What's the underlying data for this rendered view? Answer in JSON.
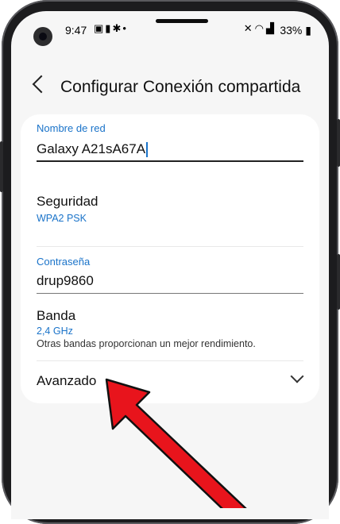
{
  "status_bar": {
    "time": "9:47",
    "left_icons": [
      "image-icon",
      "lock-icon",
      "gear-icon",
      "dot-icon"
    ],
    "right_icons": [
      "mute-icon",
      "wifi-icon",
      "signal-icon"
    ],
    "battery": "33%"
  },
  "header": {
    "title": "Configurar Conexión compartida"
  },
  "form": {
    "network_name": {
      "label": "Nombre de red",
      "value": "Galaxy A21sA67A"
    },
    "security": {
      "title": "Seguridad",
      "value": "WPA2 PSK"
    },
    "password": {
      "label": "Contraseña",
      "value": "drup9860"
    },
    "band": {
      "title": "Banda",
      "value": "2,4 GHz",
      "note": "Otras bandas proporcionan un mejor rendimiento."
    },
    "advanced": {
      "title": "Avanzado"
    }
  },
  "colors": {
    "accent": "#1a73c9",
    "arrow": "#e8141c"
  }
}
